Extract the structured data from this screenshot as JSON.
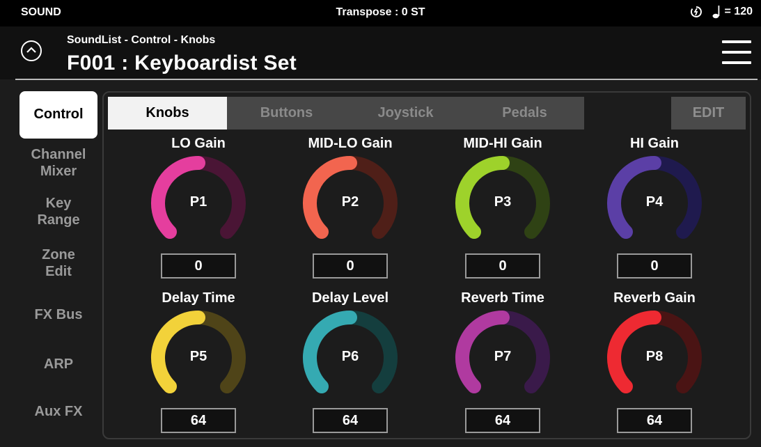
{
  "status": {
    "mode": "SOUND",
    "transpose": "Transpose : 0 ST",
    "tempo": "= 120"
  },
  "header": {
    "breadcrumb": "SoundList - Control - Knobs",
    "title": "F001 : Keyboardist Set"
  },
  "sidebar": {
    "items": [
      {
        "label": "Control",
        "active": true
      },
      {
        "label": "Channel\nMixer"
      },
      {
        "label": "Key\nRange"
      },
      {
        "label": "Zone\nEdit"
      },
      {
        "label": "FX Bus"
      },
      {
        "label": "ARP"
      },
      {
        "label": "Aux FX"
      }
    ]
  },
  "tabs": [
    {
      "label": "Knobs",
      "active": true
    },
    {
      "label": "Buttons"
    },
    {
      "label": "Joystick"
    },
    {
      "label": "Pedals"
    }
  ],
  "edit_label": "EDIT",
  "knobs": [
    {
      "name": "LO Gain",
      "p": "P1",
      "value": "0",
      "color": "#e53e9e",
      "dark": "#4a1535",
      "level": 0.5
    },
    {
      "name": "MID-LO Gain",
      "p": "P2",
      "value": "0",
      "color": "#f2654f",
      "dark": "#4f1f18",
      "level": 0.5
    },
    {
      "name": "MID-HI Gain",
      "p": "P3",
      "value": "0",
      "color": "#9ed22b",
      "dark": "#2f4214",
      "level": 0.5
    },
    {
      "name": "HI Gain",
      "p": "P4",
      "value": "0",
      "color": "#5b3fa6",
      "dark": "#1f1a4e",
      "level": 0.5
    },
    {
      "name": "Delay Time",
      "p": "P5",
      "value": "64",
      "color": "#f2d23a",
      "dark": "#4f4418",
      "level": 0.5
    },
    {
      "name": "Delay Level",
      "p": "P6",
      "value": "64",
      "color": "#35aab2",
      "dark": "#143e3e",
      "level": 0.5
    },
    {
      "name": "Reverb Time",
      "p": "P7",
      "value": "64",
      "color": "#b03aa0",
      "dark": "#3a1a4a",
      "level": 0.5
    },
    {
      "name": "Reverb Gain",
      "p": "P8",
      "value": "64",
      "color": "#ee2a32",
      "dark": "#4a1414",
      "level": 0.5
    }
  ]
}
